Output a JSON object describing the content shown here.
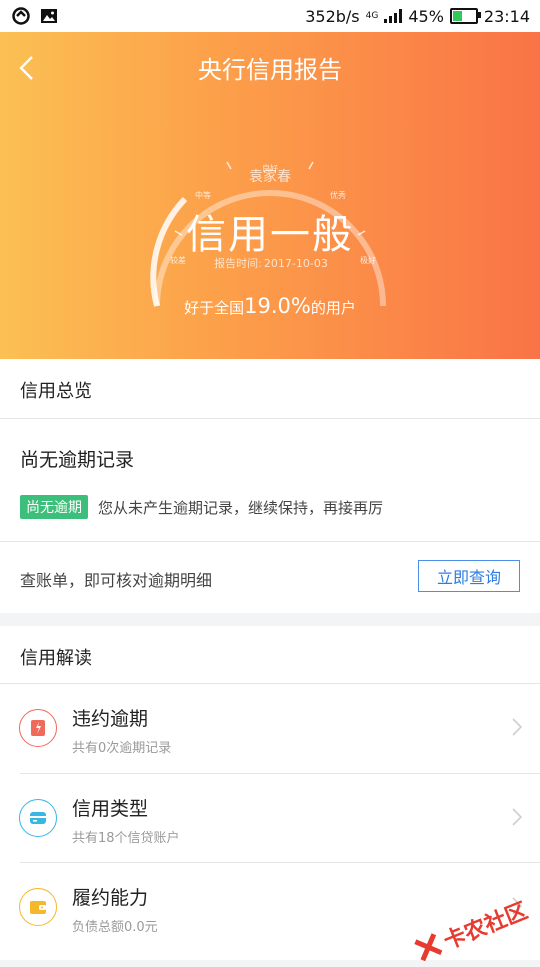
{
  "status_bar": {
    "net_speed": "352b/s",
    "network": "4G",
    "battery": "45%",
    "battery_level": 0.45,
    "time": "23:14"
  },
  "header": {
    "title": "央行信用报告",
    "back_icon": "chevron-left-icon"
  },
  "score": {
    "name": "袁家春",
    "grade": "信用一般",
    "report_date_label": "报告时间:",
    "report_date": "2017-10-03",
    "gauge_labels": [
      "较差",
      "中等",
      "良好",
      "优秀",
      "极好"
    ],
    "rank_prefix": "好于全国",
    "rank_value": "19.0%",
    "rank_suffix": "的用户"
  },
  "overview": {
    "section_title": "信用总览",
    "record_title": "尚无逾期记录",
    "badge": "尚无逾期",
    "badge_color": "#3cbf7a",
    "record_desc": "您从未产生逾期记录，继续保持，再接再厉",
    "query_hint": "查账单，即可核对逾期明细",
    "query_button": "立即查询"
  },
  "interpretation": {
    "section_title": "信用解读",
    "items": [
      {
        "title": "违约逾期",
        "subtitle": "共有0次逾期记录",
        "icon": "default-warning-icon",
        "color": "#f06a5b"
      },
      {
        "title": "信用类型",
        "subtitle": "共有18个信贷账户",
        "icon": "credit-card-icon",
        "color": "#38b6e4"
      },
      {
        "title": "履约能力",
        "subtitle": "负债总额0.0元",
        "icon": "wallet-icon",
        "color": "#f5b82a"
      }
    ]
  },
  "watermark": {
    "text": "卡农社区"
  },
  "colors": {
    "accent": "#2f7de0",
    "gradient_start": "#fbc053",
    "gradient_end": "#f97347"
  }
}
